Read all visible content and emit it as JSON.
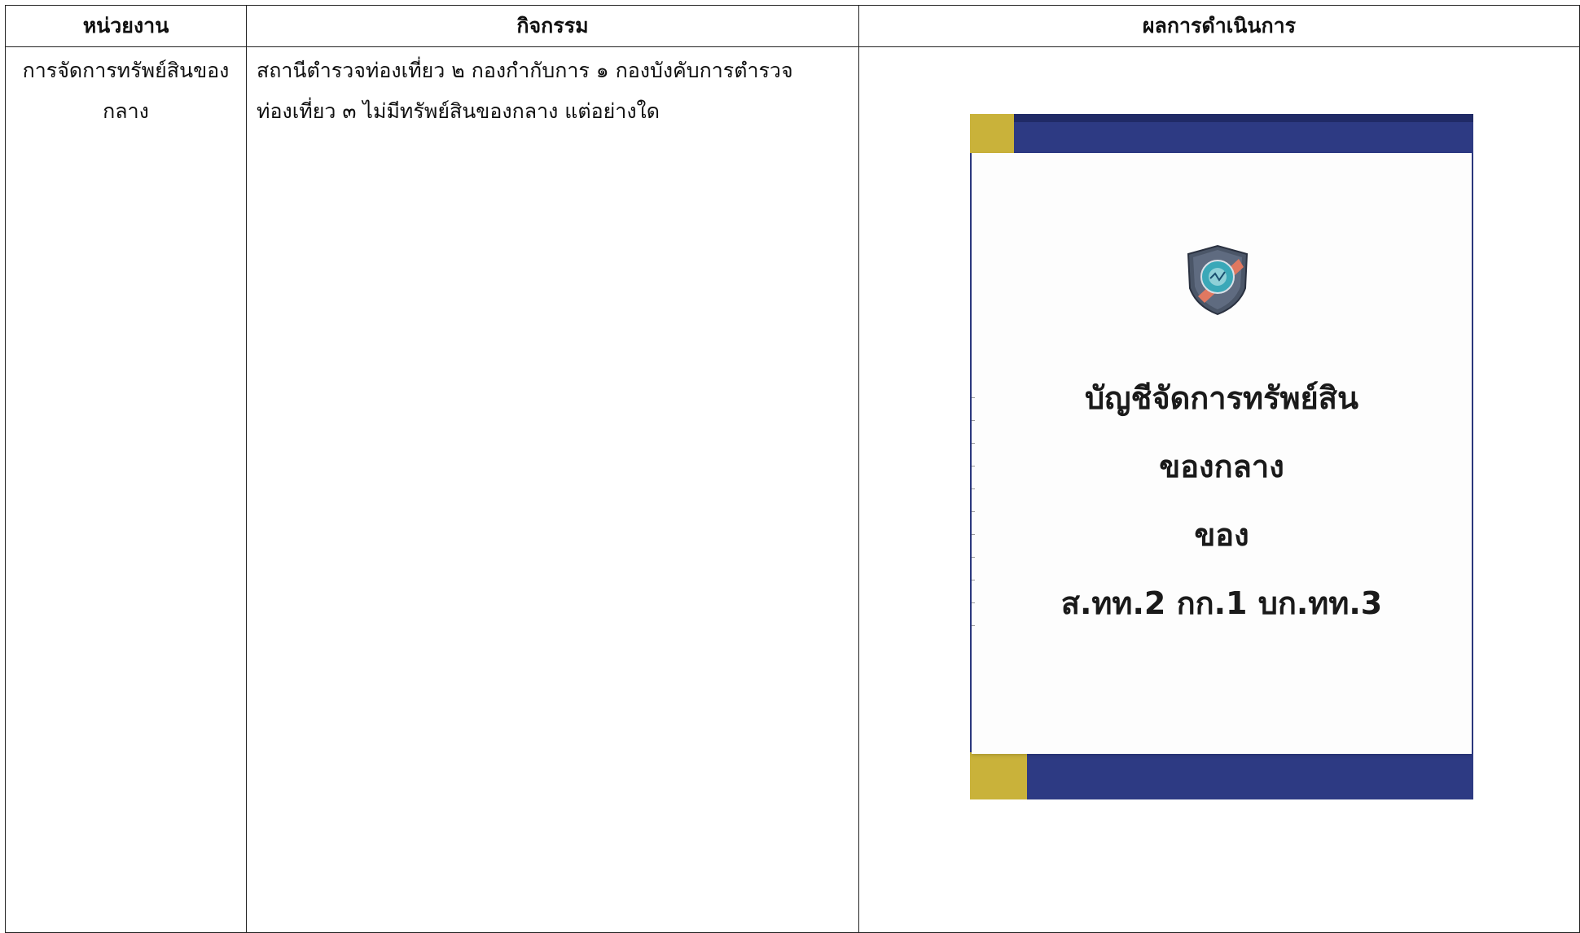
{
  "table": {
    "headers": {
      "unit": "หน่วยงาน",
      "activity": "กิจกรรม",
      "result": "ผลการดำเนินการ"
    },
    "row": {
      "unit_line1": "การจัดการทรัพย์สินของ",
      "unit_line2": "กลาง",
      "activity_line1": "สถานีตำรวจท่องเที่ยว ๒ กองกำกับการ ๑ กองบังคับการตำรวจ",
      "activity_line2": "ท่องเที่ยว ๓ ไม่มีทรัพย์สินของกลาง แต่อย่างใด"
    }
  },
  "photo": {
    "line1": "บัญชีจัดการทรัพย์สิน",
    "line2": "ของกลาง",
    "line3": "ของ",
    "line4": "ส.ทท.2 กก.1 บก.ทท.3",
    "badge_icon": "tourist-police-badge-icon",
    "colors": {
      "binder_blue": "#2d3a83",
      "spine_yellow": "#c9b23a"
    }
  }
}
